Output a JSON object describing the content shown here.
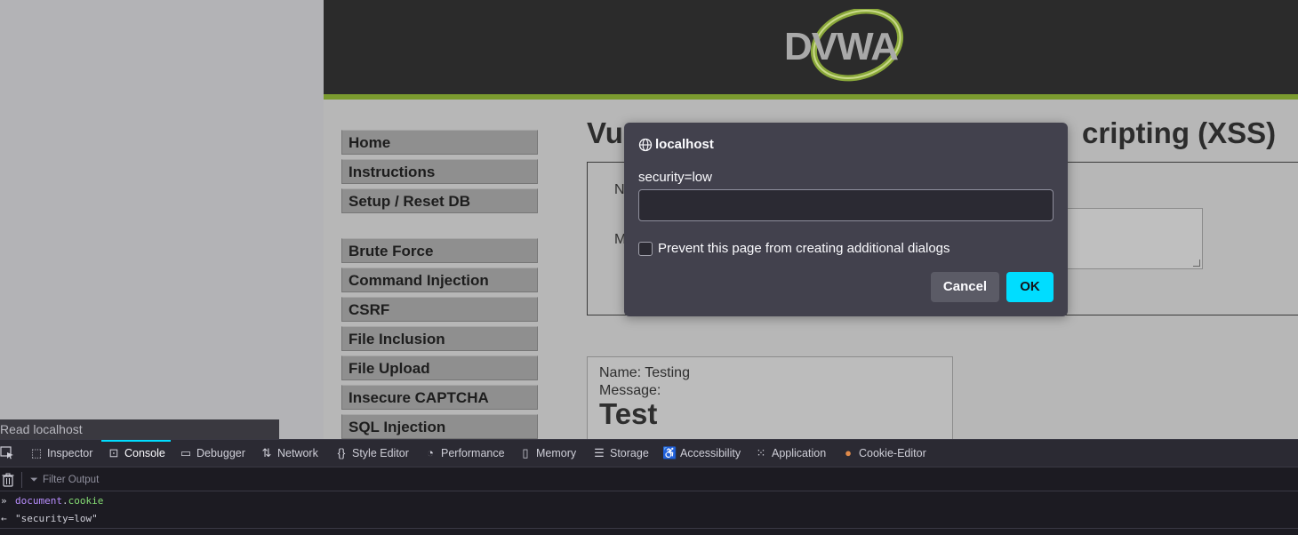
{
  "status_hover": "Read localhost",
  "site": {
    "logo_text": "DVWA",
    "menu_group1": [
      "Home",
      "Instructions",
      "Setup / Reset DB"
    ],
    "menu_group2": [
      "Brute Force",
      "Command Injection",
      "CSRF",
      "File Inclusion",
      "File Upload",
      "Insecure CAPTCHA",
      "SQL Injection"
    ],
    "heading_start": "Vu",
    "heading_end": "cripting (XSS)",
    "form_label_name": "N",
    "form_label_message": "M",
    "guestbook": {
      "name_line": "Name: Testing",
      "message_line": "Message:",
      "message_body": "Test"
    }
  },
  "dialog": {
    "title": "localhost",
    "message": "security=low",
    "input_value": "",
    "checkbox_label": "Prevent this page from creating additional dialogs",
    "cancel_label": "Cancel",
    "ok_label": "OK"
  },
  "devtools": {
    "tabs": [
      {
        "label": "Inspector",
        "icon": "inspector-icon"
      },
      {
        "label": "Console",
        "icon": "console-icon",
        "active": true
      },
      {
        "label": "Debugger",
        "icon": "debugger-icon"
      },
      {
        "label": "Network",
        "icon": "network-icon"
      },
      {
        "label": "Style Editor",
        "icon": "style-editor-icon"
      },
      {
        "label": "Performance",
        "icon": "performance-icon"
      },
      {
        "label": "Memory",
        "icon": "memory-icon"
      },
      {
        "label": "Storage",
        "icon": "storage-icon"
      },
      {
        "label": "Accessibility",
        "icon": "accessibility-icon"
      },
      {
        "label": "Application",
        "icon": "application-icon"
      },
      {
        "label": "Cookie-Editor",
        "icon": "cookie-icon"
      }
    ],
    "filter_placeholder": "Filter Output",
    "console": {
      "input_obj": "document",
      "input_dot": ".",
      "input_prop": "cookie",
      "result": "\"security=low\""
    }
  },
  "colors": {
    "accent": "#00ddff",
    "dvwa_green": "#7b9b2f",
    "dialog_bg": "#42414d",
    "devtools_bg": "#1c1b22"
  }
}
